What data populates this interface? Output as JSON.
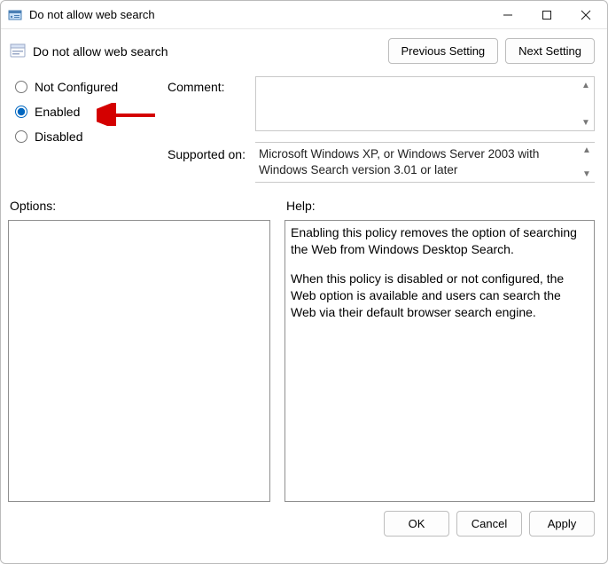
{
  "titlebar": {
    "title": "Do not allow web search"
  },
  "header": {
    "policy_name": "Do not allow web search",
    "prev_label": "Previous Setting",
    "next_label": "Next Setting"
  },
  "radios": {
    "not_configured": "Not Configured",
    "enabled": "Enabled",
    "disabled": "Disabled",
    "selected": "enabled"
  },
  "labels": {
    "comment": "Comment:",
    "supported": "Supported on:",
    "options": "Options:",
    "help": "Help:"
  },
  "comment_value": "",
  "supported_text": "Microsoft Windows XP, or Windows Server 2003 with Windows Search version 3.01 or later",
  "help_text": {
    "p1": "Enabling this policy removes the option of searching the Web from Windows Desktop Search.",
    "p2": "When this policy is disabled or not configured, the Web option is available and users can search the Web via their default browser search engine."
  },
  "footer": {
    "ok": "OK",
    "cancel": "Cancel",
    "apply": "Apply"
  }
}
